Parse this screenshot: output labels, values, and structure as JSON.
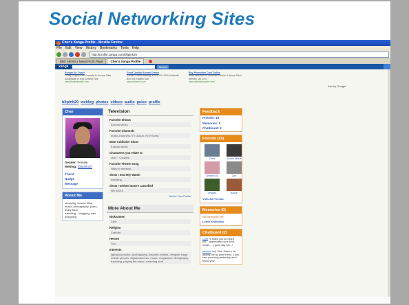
{
  "slide": {
    "title": "Social Networking Sites"
  },
  "browser": {
    "window_title": "Cher's Xanga Profile - Mozilla Firefox",
    "menu": [
      "File",
      "Edit",
      "View",
      "History",
      "Bookmarks",
      "Tools",
      "Help"
    ],
    "url": "http://profile.xanga.com/bltpink20",
    "tabs": [
      {
        "label": "BBC NEWS | News Front Page",
        "active": false
      },
      {
        "label": "Cher's Xanga Profile",
        "active": true
      }
    ],
    "toolbar": {
      "logo": "xanga",
      "search_button": "Search"
    }
  },
  "ads": [
    {
      "title": "Europe Air Travel",
      "text": "Cheap Flights from Canada to Europe Take Advantage of Your Lowest Fare",
      "url": "www.flyaairtransit.com"
    },
    {
      "title": "Good Quality Korean Drama",
      "text": "Korean Drama starting at $16.99 100% Authentic Box Set English Sub",
      "url": "www.kdrama.com"
    },
    {
      "title": "Buy Promotion Card Online",
      "text": "Wide selection of Promotion Movie & Anime Fleet delivery. Up 10%",
      "url": "www.animationsale.com"
    }
  ],
  "ads_by": "Ads by Google",
  "profile_nav": [
    "bltpink20",
    "weblog",
    "photos",
    "videos",
    "audio",
    "pulse",
    "profile"
  ],
  "profile": {
    "name": "Cher",
    "gender_label": "Gender:",
    "gender": "Female",
    "weblog_label": "Weblog:",
    "weblog": "(bltpink20)",
    "links": [
      "Friend",
      "Nudge",
      "Message"
    ],
    "about_head": "About Me",
    "about_text": "shopping, korean films, music, photography, piano, teddy bear, travelling....blogging, web designing"
  },
  "television": {
    "head": "Television",
    "items": [
      {
        "q": "Favorite Shows",
        "a": "Korean series"
      },
      {
        "q": "Favorite Channels",
        "a": "music channels, VV Dokuh, KTV Korea"
      },
      {
        "q": "Most Addictive Show",
        "a": "Korean series"
      },
      {
        "q": "Characters you relate to",
        "a": "cher ~ Cookies"
      },
      {
        "q": "Favorite Theme Song",
        "a": "Hairy to mention..."
      },
      {
        "q": "Show I Secretly Watch",
        "a": "wrestling"
      },
      {
        "q": "Show I wished wasn't cancelled",
        "a": "NN 90210"
      }
    ],
    "add_link": "Add to Your Profile"
  },
  "more_about": {
    "head": "More About Me",
    "items": [
      {
        "q": "Nicknames",
        "a": "Cher"
      },
      {
        "q": "Religion",
        "a": "Catholic"
      },
      {
        "q": "Heroes",
        "a": "God"
      },
      {
        "q": "Interests",
        "a": "laptop/computer, photography, branded clothes, designer bags, mobile phones, digital cameras, music, magazines, filmography, travelling, playing the piano, collecting stuff"
      }
    ]
  },
  "feedback": {
    "head": "Feedback",
    "friends": "Friends: 19",
    "memories": "Memories: 0",
    "chatboard": "Chatboard: 2"
  },
  "friends": {
    "head": "Friends (19)",
    "list": [
      {
        "name": "Chris",
        "color": "#6b7d92"
      },
      {
        "name": "Jessie Marie",
        "color": "#3a3a3a"
      },
      {
        "name": "Charlie102",
        "color": "#d49aa6"
      },
      {
        "name": "Zoe",
        "color": "#8a8a8a"
      },
      {
        "name": "Jessie4",
        "color": "#3d5e2a"
      },
      {
        "name": "Bruce",
        "color": "#9b5a3a"
      }
    ],
    "view_all": "View All Friends"
  },
  "memories": {
    "head": "Memories (0)",
    "empty": "No Memories Yet.",
    "link": "Leave a Memory"
  },
  "chatboard": {
    "head": "Chatboard (2)",
    "entries": [
      {
        "who": "Cher",
        "text": "Hi thank you so much too... appreciated your kind words... :) good day too...!"
      },
      {
        "who": "jasmine",
        "text": "hey Cher thank u for adding me as your friend. :) just saw your blog yesterday and I found your"
      }
    ]
  },
  "colors": {
    "title_blue": "#1f7ab8",
    "xanga_blue": "#3c6dc3",
    "orange": "#e68a1a"
  }
}
